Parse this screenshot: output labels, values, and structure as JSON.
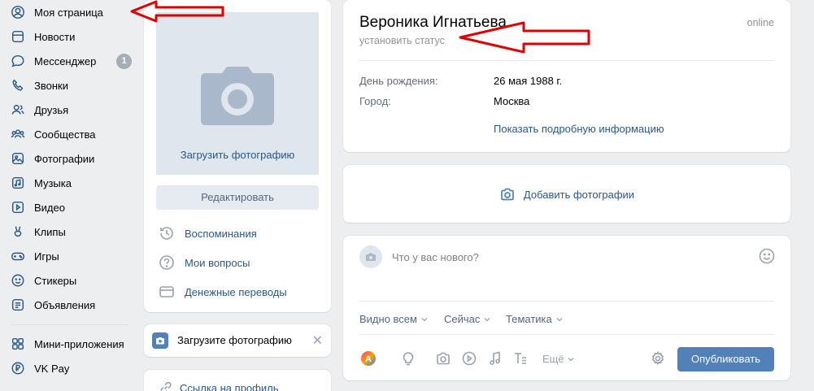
{
  "nav": {
    "items": [
      {
        "label": "Моя страница",
        "icon": "user-circle-icon"
      },
      {
        "label": "Новости",
        "icon": "news-icon"
      },
      {
        "label": "Мессенджер",
        "icon": "message-icon",
        "badge": "1"
      },
      {
        "label": "Звонки",
        "icon": "phone-icon"
      },
      {
        "label": "Друзья",
        "icon": "friends-icon"
      },
      {
        "label": "Сообщества",
        "icon": "communities-icon"
      },
      {
        "label": "Фотографии",
        "icon": "photo-icon"
      },
      {
        "label": "Музыка",
        "icon": "music-icon"
      },
      {
        "label": "Видео",
        "icon": "video-icon"
      },
      {
        "label": "Клипы",
        "icon": "clips-icon"
      },
      {
        "label": "Игры",
        "icon": "gamepad-icon"
      },
      {
        "label": "Стикеры",
        "icon": "sticker-icon"
      },
      {
        "label": "Объявления",
        "icon": "ads-icon"
      }
    ],
    "secondary": [
      {
        "label": "Мини-приложения",
        "icon": "apps-icon"
      },
      {
        "label": "VK Pay",
        "icon": "vkpay-icon"
      }
    ]
  },
  "photo_card": {
    "upload_label": "Загрузить фотографию",
    "edit_label": "Редактировать",
    "links": [
      {
        "label": "Воспоминания",
        "icon": "history-icon"
      },
      {
        "label": "Мои вопросы",
        "icon": "question-icon"
      },
      {
        "label": "Денежные переводы",
        "icon": "wallet-icon"
      }
    ]
  },
  "upload_banner": {
    "label": "Загрузите фотографию",
    "close": "✕"
  },
  "profile_link": {
    "label": "Ссылка на профиль"
  },
  "profile": {
    "name": "Вероника Игнатьева",
    "status_placeholder": "установить статус",
    "online": "online",
    "info": [
      {
        "key": "День рождения:",
        "value": "26 мая 1988 г."
      },
      {
        "key": "Город:",
        "value": "Москва"
      }
    ],
    "more_label": "Показать подробную информацию"
  },
  "add_photos": {
    "label": "Добавить фотографии"
  },
  "composer": {
    "placeholder": "Что у вас нового?",
    "options": [
      {
        "label": "Видно всем"
      },
      {
        "label": "Сейчас"
      },
      {
        "label": "Тематика"
      }
    ],
    "more_label": "Ещё",
    "publish_label": "Опубликовать"
  },
  "colors": {
    "accent": "#5181b8",
    "annotation": "#e10000",
    "background": "#edeef0"
  }
}
